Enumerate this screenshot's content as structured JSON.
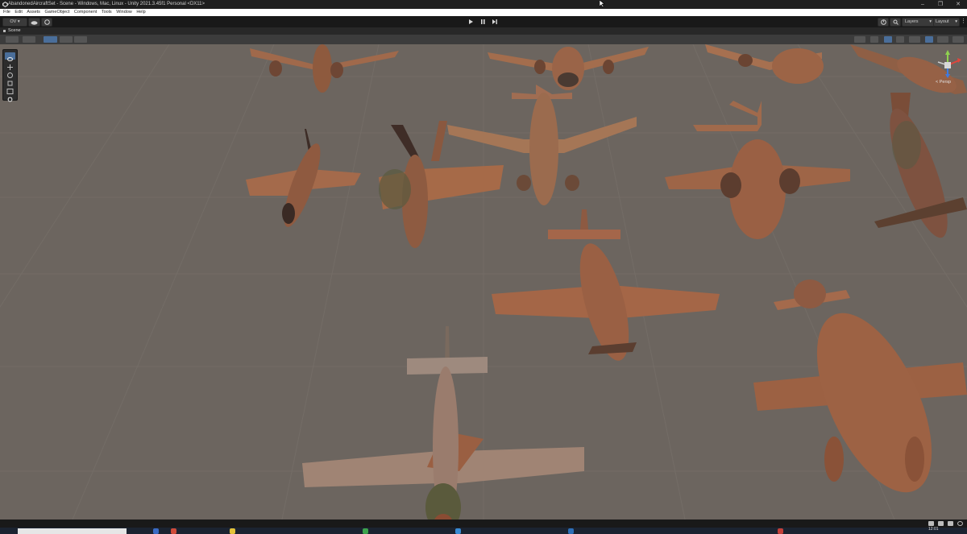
{
  "window": {
    "title": "AbandonedAircraftSet - Scene - Windows, Mac, Linux - Unity 2021.3.45f1 Personal <DX11>"
  },
  "menu": [
    "File",
    "Edit",
    "Assets",
    "GameObject",
    "Component",
    "Tools",
    "Window",
    "Help"
  ],
  "toolbar": {
    "account_label": "OV",
    "layers_label": "Layers",
    "layout_label": "Layout"
  },
  "scene_tab": {
    "label": "Scene"
  },
  "scene_view": {
    "projection_label": "< Persp"
  },
  "taskbar": {
    "clock": "12:01"
  },
  "colors": {
    "accent": "#4a6e9a",
    "viewport_background": "#6c655f",
    "rust": "#9a5a3a"
  },
  "icons": [
    "unity-logo-icon",
    "minimize-icon",
    "restore-icon",
    "close-icon",
    "cloud-icon",
    "play-icon",
    "pause-icon",
    "step-icon",
    "history-icon",
    "search-icon",
    "hand-tool-icon",
    "move-tool-icon",
    "rotate-tool-icon",
    "scale-tool-icon",
    "rect-tool-icon",
    "transform-tool-icon",
    "axis-gizmo-icon"
  ]
}
